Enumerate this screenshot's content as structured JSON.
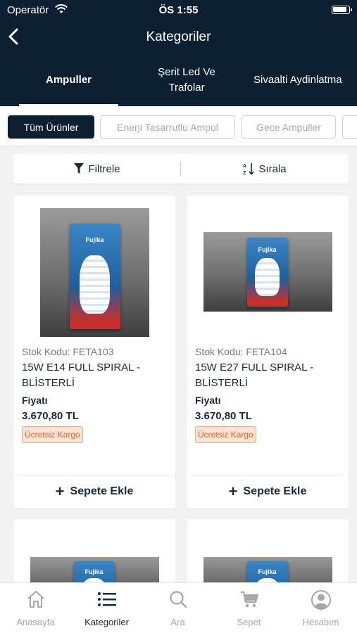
{
  "status_bar": {
    "carrier": "Operatör",
    "time": "ÖS 1:55"
  },
  "nav": {
    "title": "Kategoriler"
  },
  "category_tabs": [
    {
      "label": "Ampuller",
      "active": true
    },
    {
      "label": "Şerit Led Ve Trafolar",
      "active": false
    },
    {
      "label": "Sivaalti Aydinlatma",
      "active": false
    }
  ],
  "filter_chips": [
    {
      "label": "Tüm Ürünler",
      "active": true
    },
    {
      "label": "Enerji Tasarruflu Ampul",
      "active": false
    },
    {
      "label": "Gece Ampuller",
      "active": false
    }
  ],
  "toolbar": {
    "filter_label": "Filtrele",
    "sort_label": "Sırala"
  },
  "products": [
    {
      "code": "Stok Kodu: FETA103",
      "name": "15W E14 FULL SPIRAL - BLİSTERLİ",
      "price_label": "Fiyatı",
      "price": "3.670,80 TL",
      "badge": "Ücretsiz Kargo",
      "cart_label": "Sepete Ekle",
      "image_brand": "Fujika"
    },
    {
      "code": "Stok Kodu: FETA104",
      "name": "15W E27 FULL SPIRAL - BLİSTERLİ",
      "price_label": "Fiyatı",
      "price": "3.670,80 TL",
      "badge": "Ücretsiz Kargo",
      "cart_label": "Sepete Ekle",
      "image_brand": "Fujika"
    },
    {
      "image_brand": "Fujika"
    },
    {
      "image_brand": "Fujika"
    }
  ],
  "tabbar": [
    {
      "label": "Anasayfa",
      "icon": "home-icon",
      "active": false
    },
    {
      "label": "Kategoriler",
      "icon": "list-icon",
      "active": true
    },
    {
      "label": "Ara",
      "icon": "search-icon",
      "active": false
    },
    {
      "label": "Sepet",
      "icon": "cart-icon",
      "active": false
    },
    {
      "label": "Hesabım",
      "icon": "account-icon",
      "active": false
    }
  ],
  "colors": {
    "header_bg": "#0d1f33",
    "accent_orange": "#e8602c",
    "inactive_tab": "#a7a7a7"
  }
}
